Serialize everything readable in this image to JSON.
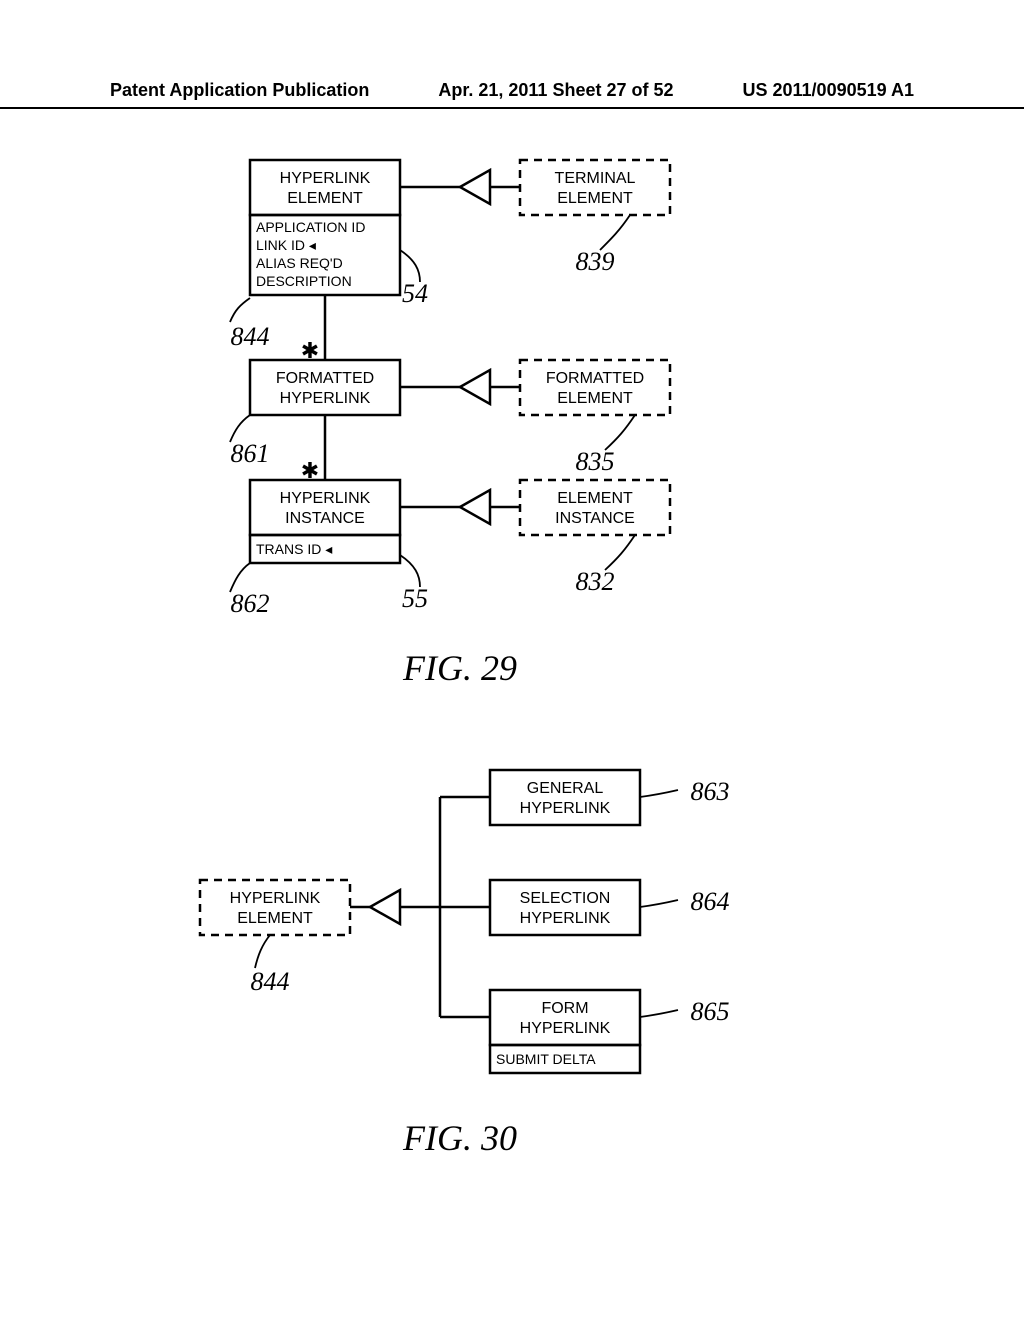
{
  "header": {
    "left": "Patent Application Publication",
    "mid": "Apr. 21, 2011  Sheet 27 of 52",
    "right": "US 2011/0090519 A1"
  },
  "fig29": {
    "caption": "FIG. 29",
    "hyperlink_element": {
      "title_l1": "HYPERLINK",
      "title_l2": "ELEMENT",
      "attrs": [
        "APPLICATION ID",
        "LINK ID ◂",
        "ALIAS REQ'D",
        "DESCRIPTION"
      ],
      "ref": "844",
      "arrow_ref": "54"
    },
    "terminal_element": {
      "title_l1": "TERMINAL",
      "title_l2": "ELEMENT",
      "ref": "839"
    },
    "formatted_hyperlink": {
      "title_l1": "FORMATTED",
      "title_l2": "HYPERLINK",
      "ref": "861"
    },
    "formatted_element": {
      "title_l1": "FORMATTED",
      "title_l2": "ELEMENT",
      "ref": "835"
    },
    "hyperlink_instance": {
      "title_l1": "HYPERLINK",
      "title_l2": "INSTANCE",
      "trans": "TRANS ID ◂",
      "ref": "862",
      "arrow_ref": "55"
    },
    "element_instance": {
      "title_l1": "ELEMENT",
      "title_l2": "INSTANCE",
      "ref": "832"
    },
    "star": "✱"
  },
  "fig30": {
    "caption": "FIG. 30",
    "hyperlink_element": {
      "title_l1": "HYPERLINK",
      "title_l2": "ELEMENT",
      "ref": "844"
    },
    "general_hyperlink": {
      "title_l1": "GENERAL",
      "title_l2": "HYPERLINK",
      "ref": "863"
    },
    "selection_hyperlink": {
      "title_l1": "SELECTION",
      "title_l2": "HYPERLINK",
      "ref": "864"
    },
    "form_hyperlink": {
      "title_l1": "FORM",
      "title_l2": "HYPERLINK",
      "attr": "SUBMIT DELTA",
      "ref": "865"
    }
  }
}
